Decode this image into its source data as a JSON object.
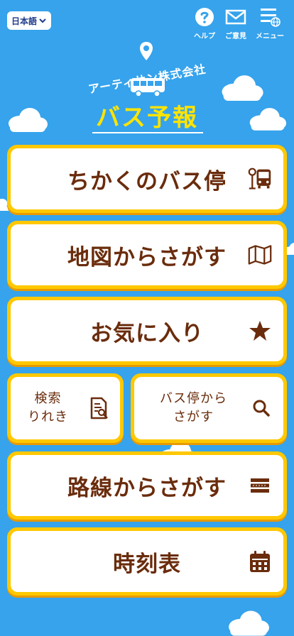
{
  "header": {
    "language": "日本語",
    "help_label": "ヘルプ",
    "feedback_label": "ご意見",
    "menu_label": "メニュー"
  },
  "logo": {
    "company": "アーティサン株式会社",
    "title": "バス予報"
  },
  "menu": {
    "nearby_stops": "ちかくのバス停",
    "search_map": "地図からさがす",
    "favorites": "お気に入り",
    "history": "検索\nりれき",
    "search_stop": "バス停から\nさがす",
    "search_route": "路線からさがす",
    "timetable": "時刻表"
  },
  "colors": {
    "background": "#36a3ec",
    "card_border": "#ffc800",
    "text_brown": "#6a2c0c",
    "logo_yellow": "#ffe400"
  }
}
